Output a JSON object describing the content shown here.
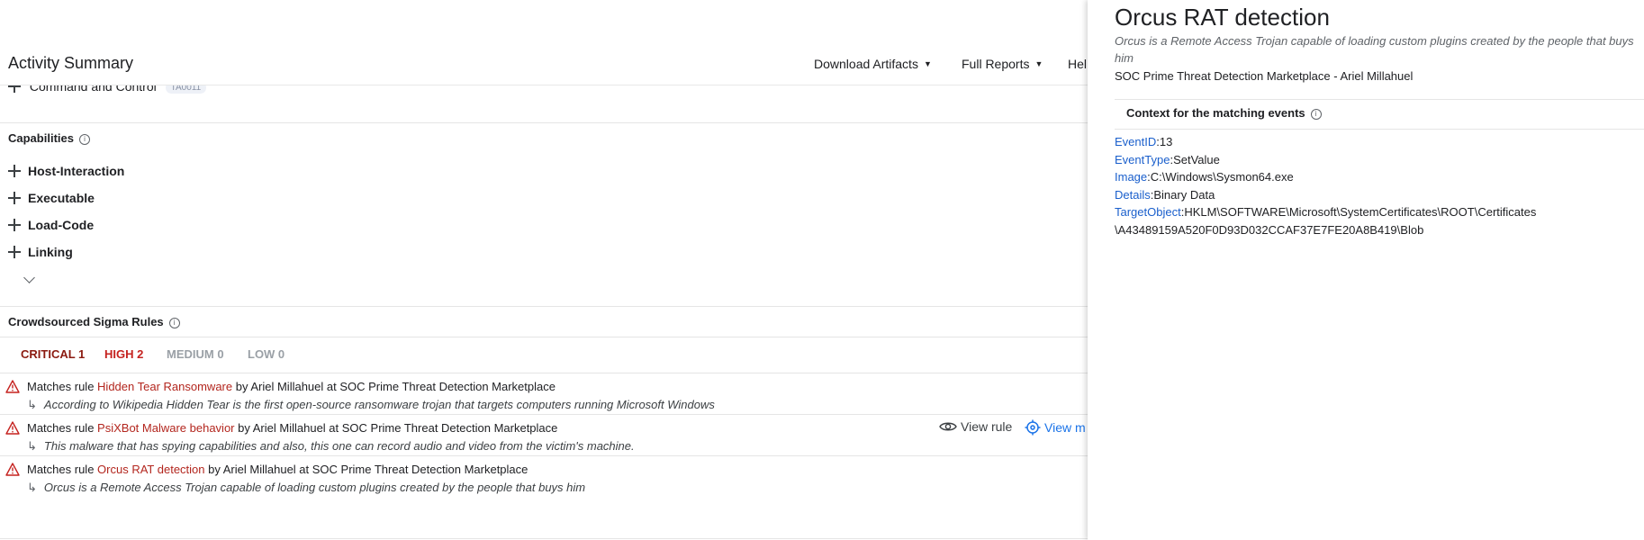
{
  "header": {
    "title": "Activity Summary",
    "download_artifacts": "Download Artifacts",
    "full_reports": "Full Reports",
    "help": "Hel"
  },
  "tactic": {
    "label": "Command and Control",
    "tag": "TA0011"
  },
  "capabilities": {
    "title": "Capabilities",
    "items": [
      "Host-Interaction",
      "Executable",
      "Load-Code",
      "Linking"
    ]
  },
  "sigma": {
    "title": "Crowdsourced Sigma Rules",
    "tabs": [
      {
        "label": "CRITICAL 1",
        "color": "#8b1a10"
      },
      {
        "label": "HIGH 2",
        "color": "#c5221f"
      },
      {
        "label": "MEDIUM 0",
        "color": "#9aa0a6"
      },
      {
        "label": "LOW 0",
        "color": "#9aa0a6"
      }
    ],
    "rules": [
      {
        "prefix": "Matches rule",
        "name": "Hidden Tear Ransomware",
        "suffix": "by Ariel Millahuel at SOC Prime Threat Detection Marketplace",
        "description": "According to Wikipedia Hidden Tear is the first open-source ransomware trojan that targets computers running Microsoft Windows"
      },
      {
        "prefix": "Matches rule",
        "name": "PsiXBot Malware behavior",
        "suffix": "by Ariel Millahuel at SOC Prime Threat Detection Marketplace",
        "description": "This malware that has spying capabilities and also, this one can record audio and video from the victim's machine."
      },
      {
        "prefix": "Matches rule",
        "name": "Orcus RAT detection",
        "suffix": "by Ariel Millahuel at SOC Prime Threat Detection Marketplace",
        "description": "Orcus is a Remote Access Trojan capable of loading custom plugins created by the people that buys him"
      }
    ],
    "view_rule": "View rule",
    "view_more": "View m"
  },
  "panel": {
    "title": "Orcus RAT detection",
    "subtitle": "Orcus is a Remote Access Trojan capable of loading custom plugins created by the people that buys him",
    "author": "SOC Prime Threat Detection Marketplace - Ariel Millahuel",
    "context_title": "Context for the matching events",
    "fields": [
      {
        "key": "EventID",
        "value": "13"
      },
      {
        "key": "EventType",
        "value": "SetValue"
      },
      {
        "key": "Image",
        "value": "C:\\Windows\\Sysmon64.exe"
      },
      {
        "key": "Details",
        "value": "Binary Data"
      },
      {
        "key": "TargetObject",
        "value": "HKLM\\SOFTWARE\\Microsoft\\SystemCertificates\\ROOT\\Certificates"
      }
    ],
    "target_object_cont": "\\A43489159A520F0D93D032CCAF37E7FE20A8B419\\Blob"
  },
  "colors": {
    "accent_link": "#1a5fcc",
    "rule_link": "#b3261e",
    "warning": "#c5221f"
  },
  "icons": [
    "plus-icon",
    "info-icon",
    "chevron-down-icon",
    "warning-icon",
    "eye-icon",
    "target-icon"
  ]
}
